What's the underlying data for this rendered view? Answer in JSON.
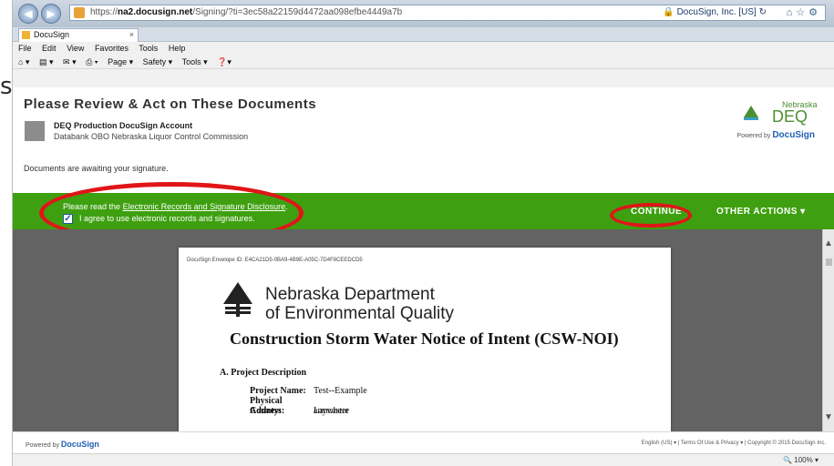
{
  "left_edge": {
    "glyph": "s"
  },
  "browser": {
    "url_prefix": "https://",
    "url_host": "na2.docusign.net",
    "url_rest": "/Signing/?ti=3ec58a22159d4472aa098efbe4449a7b",
    "site_identity": "DocuSign, Inc. [US]",
    "tab_title": "DocuSign",
    "menu": [
      "File",
      "Edit",
      "View",
      "Favorites",
      "Tools",
      "Help"
    ],
    "commands": [
      "Page ▾",
      "Safety ▾",
      "Tools ▾"
    ],
    "zoom": "100%"
  },
  "docusign": {
    "page_title": "Please Review & Act on These Documents",
    "sender_name": "DEQ Production DocuSign Account",
    "sender_org": "Databank OBO Nebraska Liquor Control Commission",
    "status": "Documents are awaiting your signature.",
    "brand_top": "Nebraska",
    "brand_main": "DEQ",
    "powered_by_prefix": "Powered by",
    "powered_by_brand": "DocuSign",
    "disclosure_prefix": "Please read the",
    "disclosure_link": "Electronic Records and Signature Disclosure",
    "agree_label": "I agree to use electronic records and signatures.",
    "continue_label": "CONTINUE",
    "other_actions_label": "OTHER ACTIONS ▾"
  },
  "document": {
    "envelope_id": "DocuSign Envelope ID: E4CA21D5-0BA9-4B9E-A05C-7D4F8CEEDCD5",
    "org_line1": "Nebraska Department",
    "org_line2": "of Environmental Quality",
    "title": "Construction Storm Water Notice of Intent (CSW-NOI)",
    "section": "A.  Project Description",
    "fields": [
      {
        "label": "Project Name:",
        "value": "Test--Example"
      },
      {
        "label": "Physical Address:",
        "value": "anywhere"
      },
      {
        "label": "County:",
        "value": "Lancaster"
      }
    ]
  },
  "footer": {
    "powered_prefix": "Powered by",
    "powered_brand": "DocuSign",
    "links": "English (US) ▾  |  Terms Of Use & Privacy ▾  |  Copyright © 2015 DocuSign Inc."
  },
  "colors": {
    "action_bar": "#3ea010",
    "annotation": "#e01518",
    "brand_green": "#4c8f2f"
  }
}
